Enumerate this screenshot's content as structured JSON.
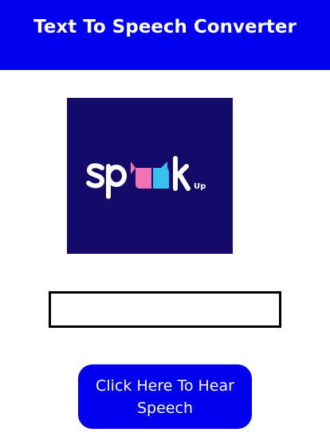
{
  "header": {
    "title": "Text To Speech Converter"
  },
  "logo": {
    "wordmark": "speak",
    "suffix": "Up",
    "colors": {
      "background": "#140a6a",
      "text": "#ffffff",
      "pink": "#f074b4",
      "blue": "#38c0f0"
    }
  },
  "input": {
    "value": "",
    "placeholder": ""
  },
  "button": {
    "label": "Click Here To Hear Speech"
  },
  "theme": {
    "accent": "#0000ef"
  }
}
